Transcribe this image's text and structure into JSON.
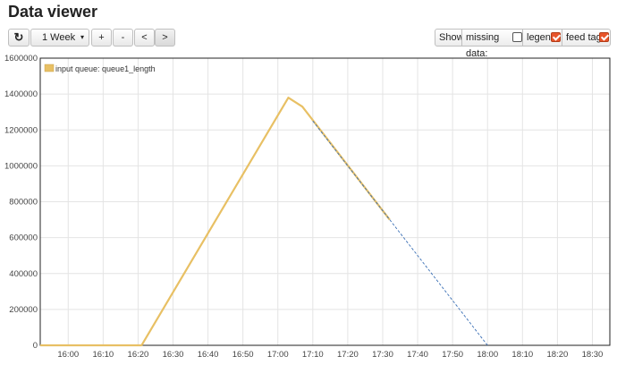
{
  "page": {
    "title": "Data viewer"
  },
  "toolbar": {
    "refresh_icon": "refresh-icon",
    "range_select": {
      "value": "1 Week"
    },
    "zoom_in_label": "+",
    "zoom_out_label": "-",
    "prev_label": "<",
    "next_label": ">"
  },
  "options": {
    "show_label": "Show",
    "missing_data_label": "missing data:",
    "missing_data_checked": false,
    "legend_label": "legend:",
    "legend_checked": true,
    "feed_tag_label": "feed tag:",
    "feed_tag_checked": true
  },
  "colors": {
    "series": "#e8c064",
    "dashed": "#3a6fb5",
    "checkbox_on": "#e8542a"
  },
  "chart_data": {
    "type": "line",
    "title": "",
    "xlabel": "",
    "ylabel": "",
    "xlim": [
      "15:52",
      "16:35"
    ],
    "ylim": [
      0,
      1600000
    ],
    "grid": true,
    "legend_position": "top-left",
    "x_ticks": [
      "16:00",
      "16:10",
      "16:20",
      "16:30",
      "16:40",
      "16:50",
      "17:00",
      "17:10",
      "17:20",
      "17:30",
      "17:40",
      "17:50",
      "18:00",
      "18:10",
      "18:20",
      "18:30"
    ],
    "y_ticks": [
      "0",
      "200000",
      "400000",
      "600000",
      "800000",
      "1000000",
      "1200000",
      "1400000",
      "1600000"
    ],
    "series": [
      {
        "name": "input queue: queue1_length",
        "style": "solid",
        "points": [
          [
            "15:52",
            0
          ],
          [
            "16:21",
            0
          ],
          [
            "17:03",
            1380000
          ],
          [
            "17:07",
            1330000
          ],
          [
            "17:32",
            700000
          ]
        ]
      },
      {
        "style": "dashed",
        "points": [
          [
            "17:10",
            1250000
          ],
          [
            "18:00",
            0
          ]
        ]
      }
    ]
  }
}
